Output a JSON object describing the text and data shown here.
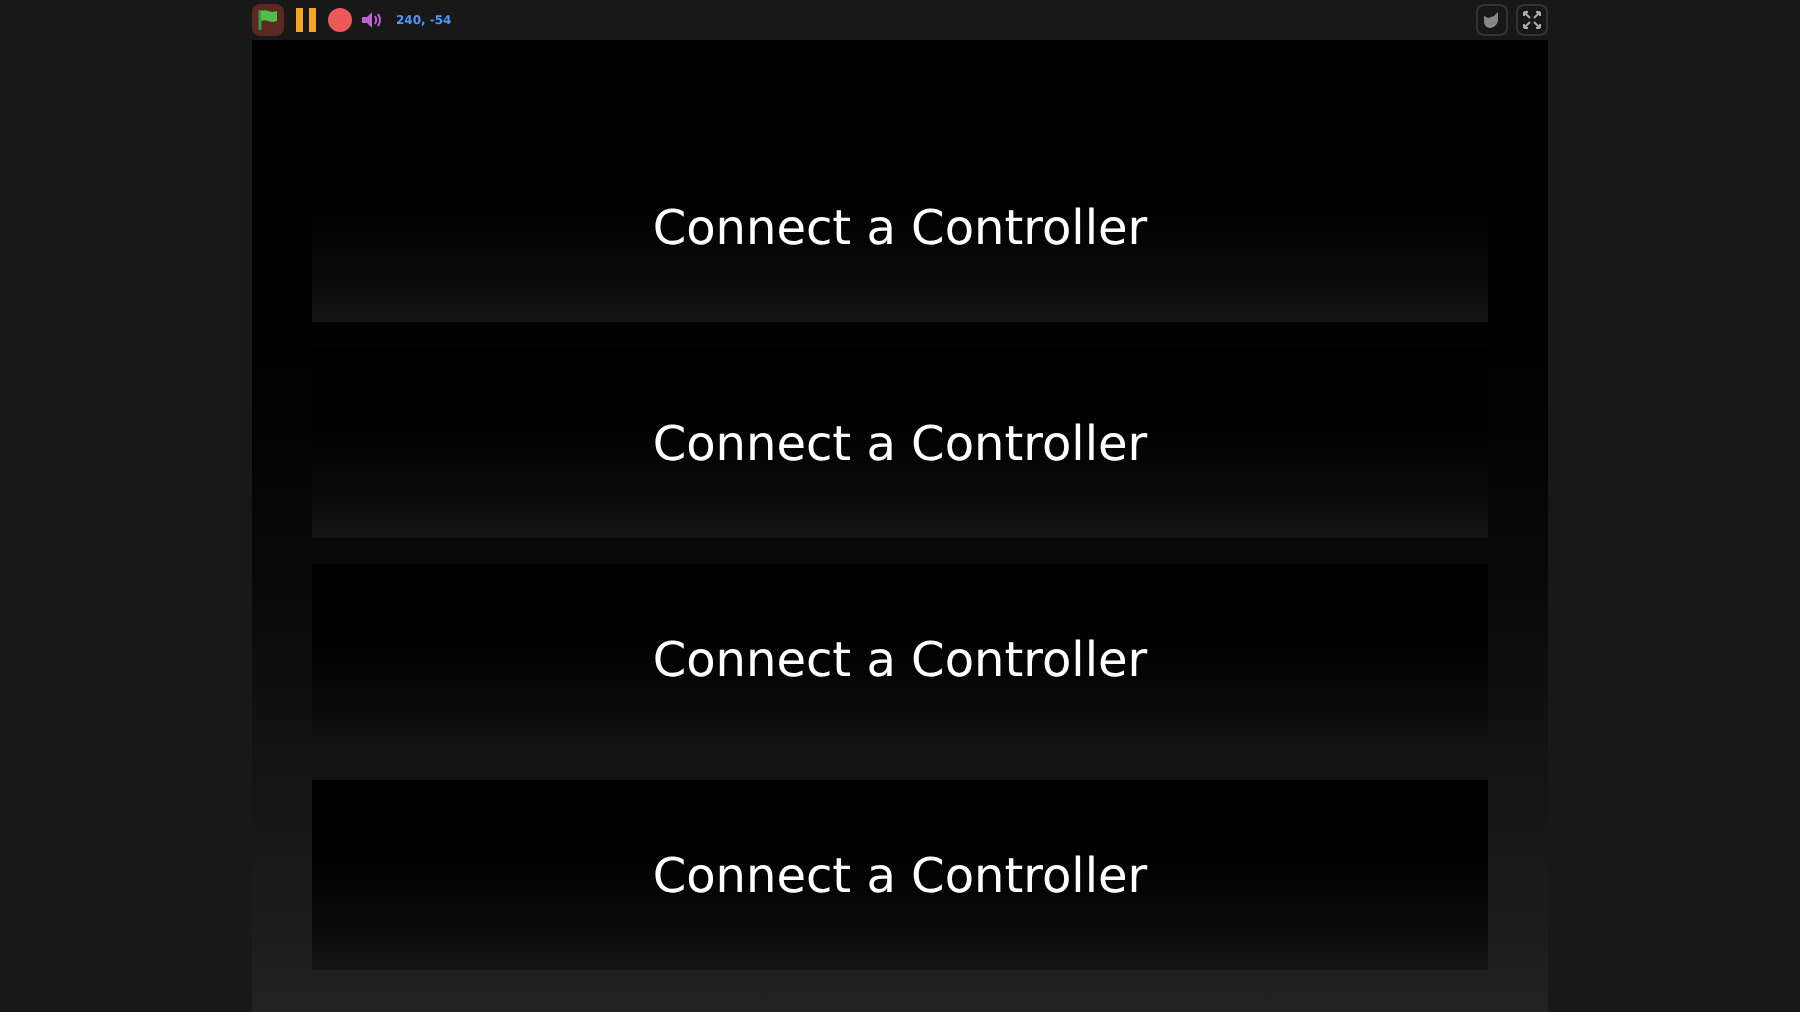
{
  "toolbar": {
    "coordinates": "240, -54"
  },
  "stage": {
    "cards": [
      {
        "label": "Connect a Controller"
      },
      {
        "label": "Connect a Controller"
      },
      {
        "label": "Connect a Controller"
      },
      {
        "label": "Connect a Controller"
      }
    ]
  }
}
